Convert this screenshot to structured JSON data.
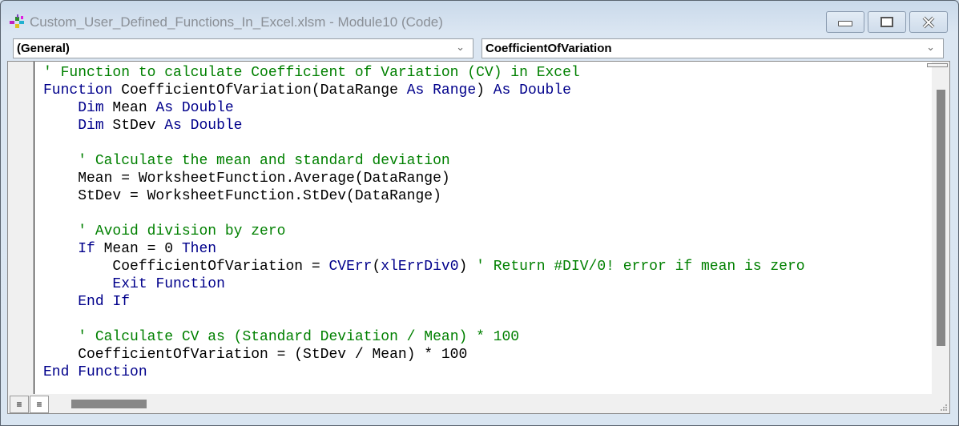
{
  "window": {
    "title": "Custom_User_Defined_Functions_In_Excel.xlsm - Module10 (Code)",
    "controls": [
      "minimize",
      "maximize",
      "close"
    ]
  },
  "object_combo": {
    "value": "(General)"
  },
  "procedure_combo": {
    "value": "CoefficientOfVariation"
  },
  "code": {
    "language": "VBA",
    "lines": [
      "' Function to calculate Coefficient of Variation (CV) in Excel",
      "Function CoefficientOfVariation(DataRange As Range) As Double",
      "    Dim Mean As Double",
      "    Dim StDev As Double",
      "",
      "    ' Calculate the mean and standard deviation",
      "    Mean = WorksheetFunction.Average(DataRange)",
      "    StDev = WorksheetFunction.StDev(DataRange)",
      "",
      "    ' Avoid division by zero",
      "    If Mean = 0 Then",
      "        CoefficientOfVariation = CVErr(xlErrDiv0) ' Return #DIV/0! error if mean is zero",
      "        Exit Function",
      "    End If",
      "",
      "    ' Calculate CV as (Standard Deviation / Mean) * 100",
      "    CoefficientOfVariation = (StDev / Mean) * 100",
      "End Function"
    ]
  },
  "view_buttons": [
    "procedure-view",
    "full-module-view"
  ],
  "colors": {
    "keyword": "#00008b",
    "comment": "#008000",
    "text": "#000000"
  }
}
